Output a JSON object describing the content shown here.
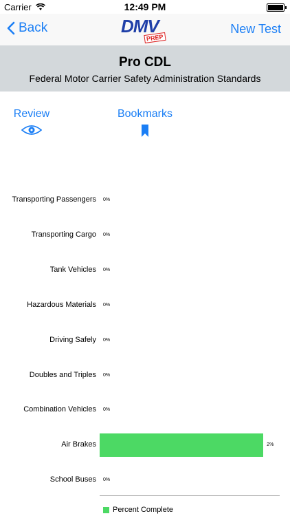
{
  "status_bar": {
    "carrier": "Carrier",
    "time": "12:49 PM"
  },
  "nav": {
    "back_label": "Back",
    "new_test_label": "New Test",
    "logo_text": "DMV",
    "logo_badge": "PREP"
  },
  "header": {
    "title": "Pro CDL",
    "subtitle": "Federal Motor Carrier Safety Administration Standards"
  },
  "tabs": {
    "review_label": "Review",
    "bookmarks_label": "Bookmarks"
  },
  "colors": {
    "accent": "#1a7ef5",
    "bar": "#4cd964",
    "header_bg": "#d3d8db"
  },
  "chart_data": {
    "type": "bar",
    "orientation": "horizontal",
    "categories": [
      "Transporting Passengers",
      "Transporting Cargo",
      "Tank Vehicles",
      "Hazardous Materials",
      "Driving Safely",
      "Doubles and Triples",
      "Combination Vehicles",
      "Air Brakes",
      "School Buses"
    ],
    "series": [
      {
        "name": "Percent Complete",
        "values": [
          0,
          0,
          0,
          0,
          0,
          0,
          0,
          2,
          0
        ]
      }
    ],
    "value_labels": [
      "0%",
      "0%",
      "0%",
      "0%",
      "0%",
      "0%",
      "0%",
      "2%",
      "0%"
    ],
    "xlim": [
      0,
      2.2
    ],
    "legend": "bottom-left"
  }
}
